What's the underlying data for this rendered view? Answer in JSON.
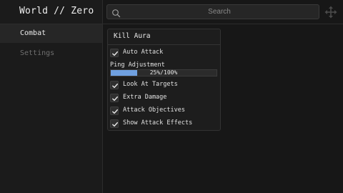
{
  "app": {
    "title": "World // Zero"
  },
  "sidebar": {
    "items": [
      {
        "label": "Combat",
        "active": true
      },
      {
        "label": "Settings",
        "active": false
      }
    ]
  },
  "search": {
    "placeholder": "Search",
    "value": ""
  },
  "toolbar": {
    "move_icon": "move-arrows-icon"
  },
  "panel": {
    "title": "Kill Aura",
    "toggles": [
      {
        "label": "Auto Attack",
        "checked": true
      },
      {
        "label": "Look At Targets",
        "checked": true
      },
      {
        "label": "Extra Damage",
        "checked": true
      },
      {
        "label": "Attack Objectives",
        "checked": true
      },
      {
        "label": "Show Attack Effects",
        "checked": true
      }
    ],
    "slider": {
      "label": "Ping Adjustment",
      "value_text": "25%/100%",
      "fraction": 0.25
    }
  },
  "colors": {
    "accent": "#6fa0e0",
    "background": "#171717",
    "sidebar": "#1b1b1b",
    "panel": "#1d1d1d"
  }
}
